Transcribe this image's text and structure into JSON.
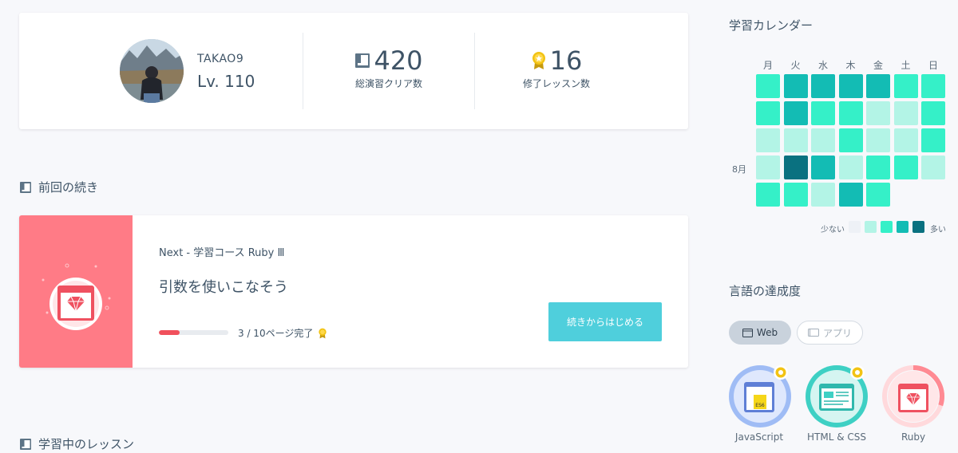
{
  "profile": {
    "username": "TAKAO9",
    "level": "Lv. 110",
    "stats": [
      {
        "value": "420",
        "label": "総演習クリア数",
        "icon": "book-icon"
      },
      {
        "value": "16",
        "label": "修了レッスン数",
        "icon": "medal-icon"
      }
    ]
  },
  "continue_section": {
    "title": "前回の続き",
    "course": "Next - 学習コース Ruby Ⅲ",
    "lesson_title": "引数を使いこなそう",
    "progress": {
      "current": 3,
      "total": 10,
      "fraction": 0.3,
      "text": "3 / 10ページ完了"
    },
    "button_label": "続きからはじめる"
  },
  "lessons_section": {
    "title": "学習中のレッスン"
  },
  "calendar": {
    "title": "学習カレンダー",
    "weekdays": [
      "月",
      "火",
      "水",
      "木",
      "金",
      "土",
      "日"
    ],
    "month_label": "8月",
    "legend_low": "少ない",
    "legend_high": "多い",
    "levels_colors": [
      "#eef1f6",
      "#b3f4e6",
      "#35f0c8",
      "#13bcb4",
      "#0a7180"
    ],
    "grid": [
      [
        2,
        3,
        3,
        3,
        3,
        2,
        2
      ],
      [
        2,
        3,
        2,
        2,
        1,
        1,
        2
      ],
      [
        1,
        1,
        1,
        2,
        1,
        1,
        2
      ],
      [
        1,
        4,
        3,
        1,
        2,
        2,
        1
      ],
      [
        2,
        2,
        1,
        3,
        2,
        null,
        null
      ]
    ]
  },
  "languages": {
    "title": "言語の達成度",
    "tabs": [
      {
        "label": "Web",
        "icon": "window-icon",
        "active": true
      },
      {
        "label": "アプリ",
        "icon": "device-icon",
        "active": false
      }
    ],
    "items": [
      {
        "name": "JavaScript",
        "color": "#9fbcf5",
        "fraction": 1.0,
        "completed": true
      },
      {
        "name": "HTML & CSS",
        "color": "#3ed0c4",
        "fraction": 1.0,
        "completed": true
      },
      {
        "name": "Ruby",
        "color": "#ff8a93",
        "fraction": 0.3,
        "completed": false
      }
    ]
  },
  "colors": {
    "accent": "#4fcfdc",
    "progress": "#f0505c",
    "ruby": "#ff7b86",
    "medal": "#f2c314"
  }
}
